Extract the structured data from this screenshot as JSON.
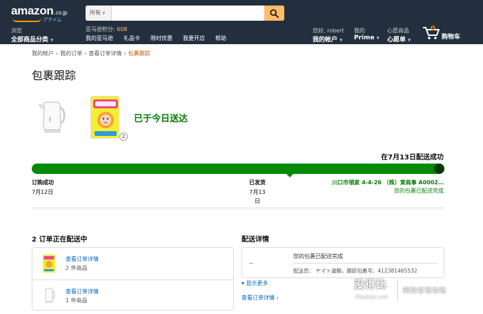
{
  "header": {
    "logo": {
      "word": "amazon",
      "tld": ".co.jp",
      "sub": "プライム"
    },
    "search": {
      "category": "所有",
      "placeholder": ""
    },
    "browse": {
      "small": "浏览",
      "big": "全部商品分类"
    },
    "points": {
      "label": "亚马逊积分:",
      "value": "608"
    },
    "top_links": [
      "我的亚马逊",
      "礼品卡",
      "限时优惠",
      "我要开店",
      "帮助"
    ],
    "account": {
      "small": "您好, robert",
      "big": "我的帐户"
    },
    "prime": {
      "small": "我的",
      "big": "Prime"
    },
    "wishlist": {
      "small": "心愿商品",
      "big": "心愿单"
    },
    "cart": {
      "count": "0",
      "label": "购物车"
    }
  },
  "breadcrumb": [
    "我的帐户",
    "我的订单",
    "查看订单详情",
    "包裹跟踪"
  ],
  "page_title": "包裹跟踪",
  "package": {
    "badge_count": "2",
    "delivered_message": "已于今日送达",
    "success_title": "在7月13日配送成功"
  },
  "tracker": {
    "progress": 1.0,
    "steps": [
      {
        "label": "订购成功",
        "date": "7月12日"
      },
      {
        "label": "已发货",
        "date_line1": "7月13",
        "date_line2": "日"
      }
    ],
    "status_address": "川口市領家 4-4-26 （株）東商事 A0002…",
    "status_done": "您的包裹已配送完成"
  },
  "orders": {
    "title": "2 订单正在配送中",
    "rows": [
      {
        "link": "查看订单详情",
        "count": "2 件商品"
      },
      {
        "link": "查看订单详情",
        "count": "1 件商品"
      }
    ]
  },
  "shipping": {
    "title": "配送详情",
    "dash": "--",
    "status": "您的包裹已配送完成",
    "carrier": "配送员： ヤマト運輸，跟踪包裹号：412381465532",
    "show_more": "显示更多",
    "view_order": "查看订单详情 ›"
  },
  "watermark": {
    "big": "没得比",
    "site": "Meidebi.com",
    "slogan": "网购省钱攻略"
  },
  "colors": {
    "nav_bg": "#232f3e",
    "accent_orange": "#febd69",
    "success_green": "#067d07",
    "link_blue": "#0066c0",
    "breadcrumb_current": "#c45500"
  }
}
